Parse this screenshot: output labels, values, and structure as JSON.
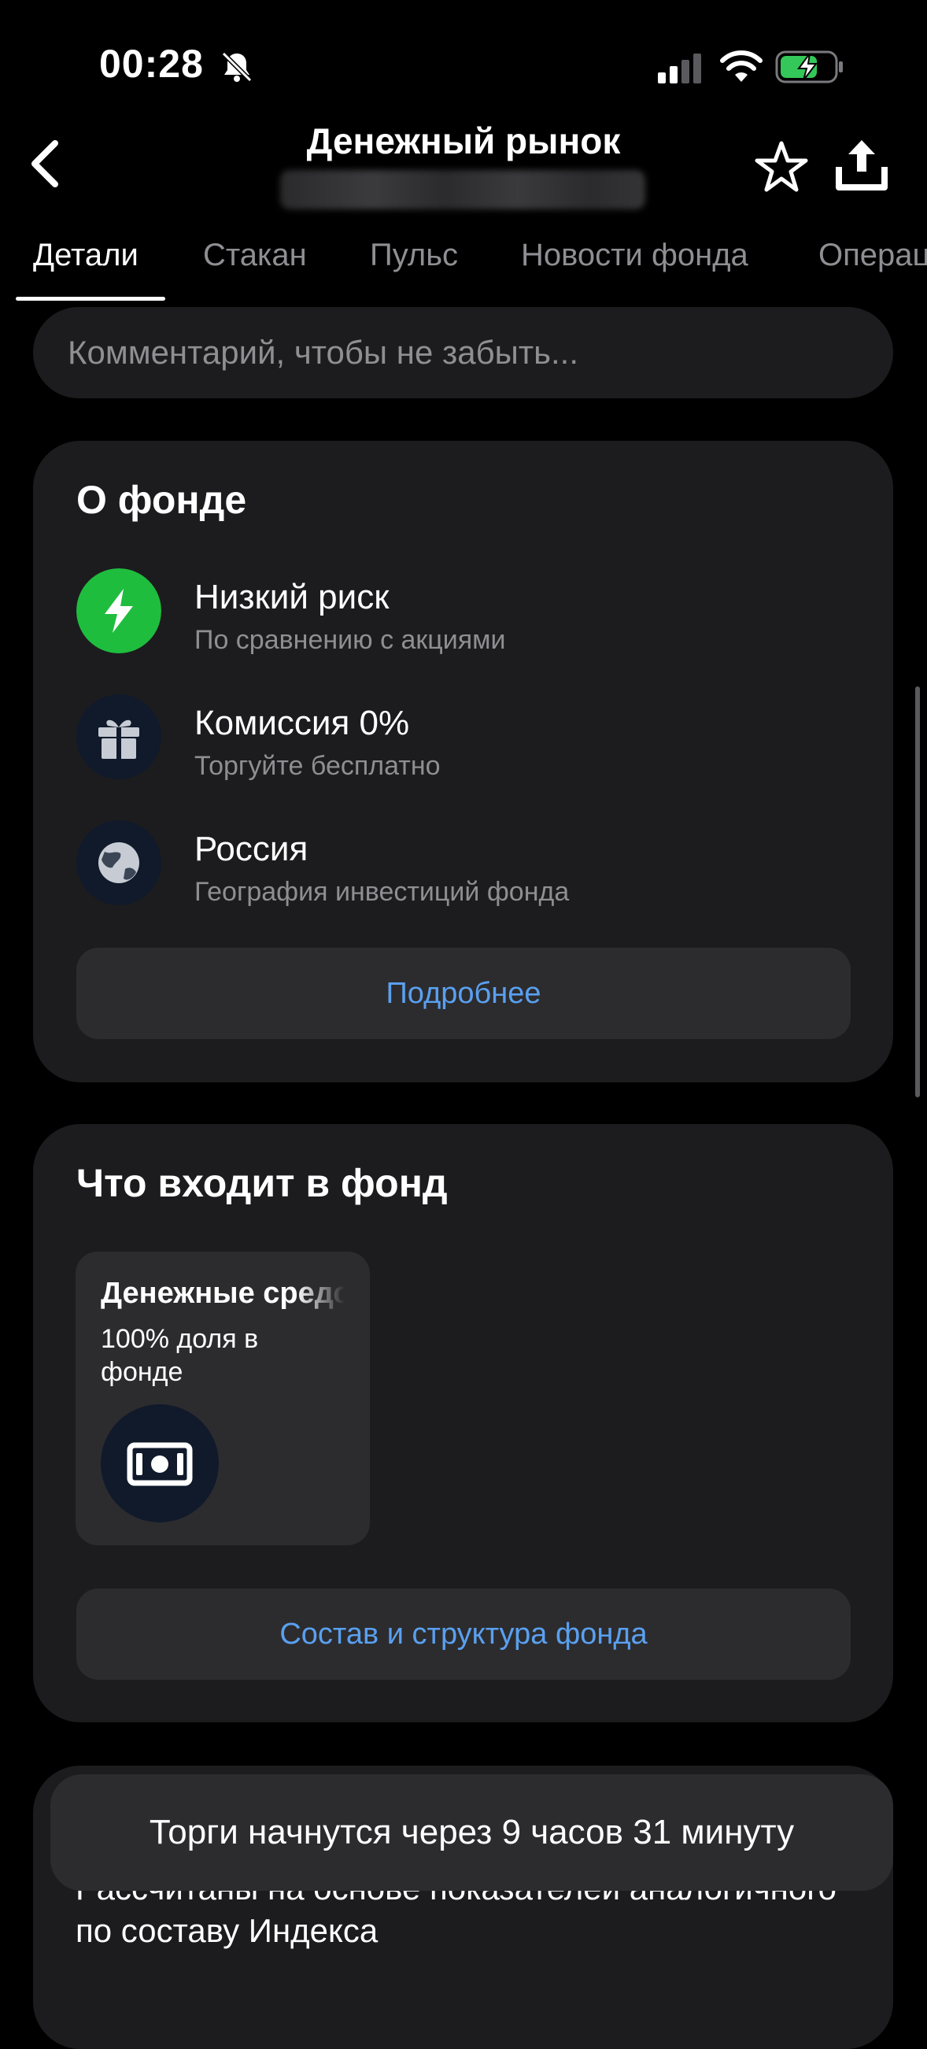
{
  "status_bar": {
    "time": "00:28",
    "icons": [
      "bell-slash-icon",
      "signal-icon",
      "wifi-icon",
      "battery-charging-icon"
    ]
  },
  "header": {
    "back_icon": "chevron-left-icon",
    "title": "Денежный рынок",
    "subtitle": "",
    "favorite_icon": "star-icon",
    "share_icon": "share-icon"
  },
  "tabs": [
    {
      "label": "Детали",
      "active": true
    },
    {
      "label": "Стакан",
      "active": false
    },
    {
      "label": "Пульс",
      "active": false
    },
    {
      "label": "Новости фонда",
      "active": false
    },
    {
      "label": "Операции",
      "active": false
    }
  ],
  "comment": {
    "placeholder": "Комментарий, чтобы не забыть...",
    "value": ""
  },
  "about": {
    "title": "О фонде",
    "features": [
      {
        "icon": "lightning-icon",
        "title": "Низкий риск",
        "subtitle": "По сравнению с акциями",
        "color": "#1fbd3e"
      },
      {
        "icon": "gift-icon",
        "title": "Комиссия 0%",
        "subtitle": "Торгуйте бесплатно",
        "color": "#101a2b"
      },
      {
        "icon": "globe-icon",
        "title": "Россия",
        "subtitle": "География инвестиций фонда",
        "color": "#101a2b"
      }
    ],
    "more_button": "Подробнее"
  },
  "composition": {
    "title": "Что входит в фонд",
    "asset": {
      "name": "Денежные средства",
      "share": "100% доля в фонде",
      "icon": "banknote-icon"
    },
    "structure_button": "Состав и структура фонда"
  },
  "metrics": {
    "text": "Рассчитаны на основе показателей аналогичного по составу Индекса"
  },
  "toast": {
    "text": "Торги начнутся через 9 часов 31 минуту"
  },
  "colors": {
    "background": "#000000",
    "card": "#1c1c1e",
    "button": "#2c2c2e",
    "link": "#5aa0f0",
    "accent_green": "#1fbd3e",
    "muted": "#8e8e93"
  }
}
